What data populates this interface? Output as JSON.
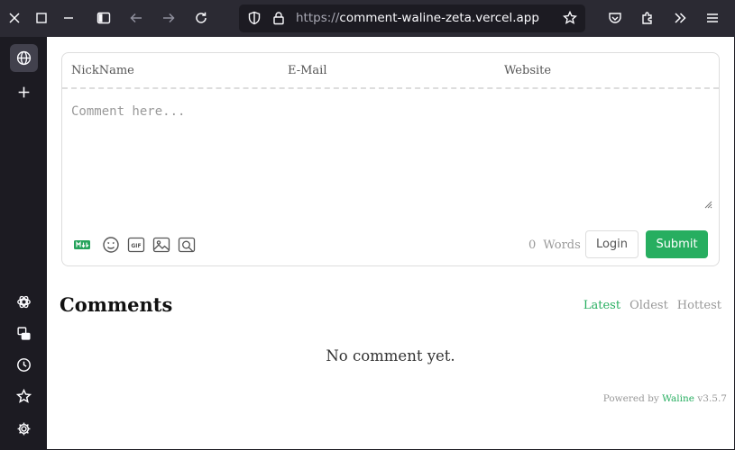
{
  "browser": {
    "url_scheme": "https://",
    "url_host": "comment-waline-zeta.vercel.app"
  },
  "sidebar": {
    "items": [
      {
        "icon": "globe-icon",
        "active": true
      },
      {
        "icon": "plus-icon"
      },
      {
        "icon": "chatgpt-icon"
      },
      {
        "icon": "synced-tabs-icon"
      },
      {
        "icon": "history-icon"
      },
      {
        "icon": "bookmark-star-icon"
      },
      {
        "icon": "settings-gear-icon"
      }
    ]
  },
  "comment_form": {
    "nickname_label": "NickName",
    "email_label": "E-Mail",
    "website_label": "Website",
    "placeholder": "Comment here...",
    "word_count": "0",
    "word_unit": "Words",
    "login_label": "Login",
    "submit_label": "Submit",
    "tools": [
      "markdown-icon",
      "emoji-icon",
      "gif-icon",
      "image-upload-icon",
      "preview-icon"
    ]
  },
  "comments": {
    "title": "Comments",
    "sort_options": [
      "Latest",
      "Oldest",
      "Hottest"
    ],
    "active_sort": "Latest",
    "empty_text": "No comment yet."
  },
  "footer": {
    "powered_by": "Powered by",
    "brand": "Waline",
    "version": "v3.5.7"
  },
  "colors": {
    "accent": "#27ae60",
    "chrome_bg": "#2b2a33",
    "sidebar_bg": "#1c1b22"
  }
}
